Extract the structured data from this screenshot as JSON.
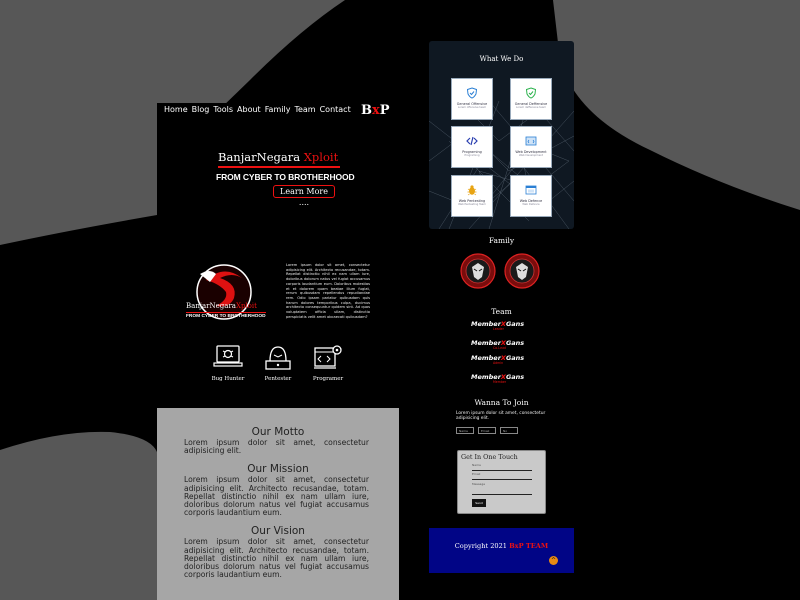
{
  "nav": {
    "links": [
      "Home",
      "Blog",
      "Tools",
      "About",
      "Family",
      "Team",
      "Contact"
    ],
    "logo": {
      "left": "B",
      "mark": "x",
      "right": "P"
    }
  },
  "hero": {
    "title": "BanjarNegara",
    "title_accent": "Xploit",
    "subtitle": "FROM CYBER TO BROTHERHOOD",
    "button": "Learn More ...."
  },
  "about": {
    "logo_title": "BanjarNegara",
    "logo_accent": "Xploit",
    "logo_subtitle": "FROM CYBER TO BROTHERHOOD",
    "text": "Lorem ipsum dolor sit amet, consectetur adipisicing elit. Architecto recusandae, totam. Repellat distinctio nihil ex nam ullam iure, doloribus dolorum natus vel fugiat accusamus corporis laudantium eum. Doloribus molestias et et dolorem quam beatae illum fugiat, rerum quibusdam repellendus repudiandae rem. Odio ipsam pariatur quibusdam quis harum dolores temporibus culpa, ducimus architecto consequuntur quidem sint. Ad quos voluptatem officia ullam, distinctio perspiciatis velit amet obcaecati quibusdam?"
  },
  "skills": [
    {
      "label": "Bug Hunter",
      "icon": "bug-hunter-icon"
    },
    {
      "label": "Pentester",
      "icon": "hacker-icon"
    },
    {
      "label": "Programer",
      "icon": "code-gear-icon"
    }
  ],
  "motto": {
    "motto_title": "Our Motto",
    "motto_text": "Lorem ipsum dolor sit amet, consectetur adipisicing elit.",
    "mission_title": "Our Mission",
    "mission_text": "Lorem ipsum dolor sit amet, consectetur adipisicing elit. Architecto recusandae, totam. Repellat distinctio nihil ex nam ullam iure, doloribus dolorum natus vel fugiat accusamus corporis laudantium eum.",
    "vision_title": "Our Vision",
    "vision_text": "Lorem ipsum dolor sit amet, consectetur adipisicing elit. Architecto recusandae, totam. Repellat distinctio nihil ex nam ullam iure, doloribus dolorum natus vel fugiat accusamus corporis laudantium eum."
  },
  "what_we_do": {
    "title": "What We Do",
    "services": [
      {
        "name": "General Offensive",
        "sub": "Lorem offensive team",
        "icon": "shield-check-icon",
        "color": "#2a7fd4"
      },
      {
        "name": "General Deffensive",
        "sub": "Lorem deffensive team",
        "icon": "shield-check-icon",
        "color": "#2bb24c"
      },
      {
        "name": "Programing",
        "sub": "Programing",
        "icon": "code-icon",
        "color": "#2a3fb0"
      },
      {
        "name": "Web Development",
        "sub": "Web Development",
        "icon": "web-dev-icon",
        "color": "#2a7fd4"
      },
      {
        "name": "Web Pentesting",
        "sub": "Web Pentesting Team",
        "icon": "bug-icon",
        "color": "#e8a413"
      },
      {
        "name": "Web Defence",
        "sub": "Web Defence",
        "icon": "browser-icon",
        "color": "#2a7fd4"
      }
    ]
  },
  "family": {
    "title": "Family"
  },
  "team": {
    "title": "Team",
    "members": [
      {
        "name": "Member",
        "mark": "X",
        "suffix": "Gans",
        "role": "Leader"
      },
      {
        "name": "Member",
        "mark": "X",
        "suffix": "Gans",
        "role": "Co-Lead"
      },
      {
        "name": "Member",
        "mark": "X",
        "suffix": "Gans",
        "role": "Admin"
      },
      {
        "name": "Member",
        "mark": "X",
        "suffix": "Gans",
        "role": "Member"
      }
    ]
  },
  "join": {
    "title": "Wanna To Join",
    "text": "Lorem ipsum dolor sit amet, consectetur adipisicing elit.",
    "fields": [
      "Nama",
      "Email",
      "No"
    ]
  },
  "contact": {
    "title": "Get In One Touch",
    "fields": [
      "Nama",
      "Email",
      "Message"
    ],
    "send": "Send"
  },
  "footer": {
    "text": "Copyright 2021",
    "brand_b": "B",
    "brand_x": "x",
    "brand_rest": "P TEAM",
    "up": "^",
    "bg": "#010586"
  }
}
